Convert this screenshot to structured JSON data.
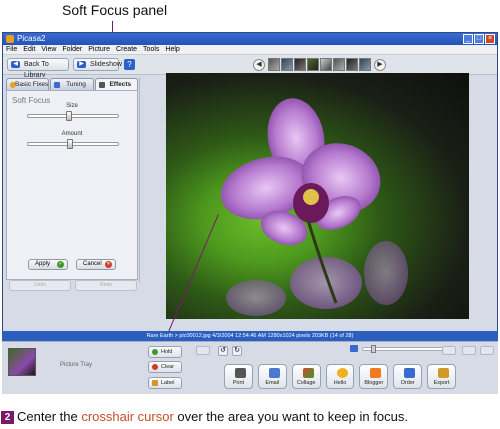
{
  "callout_top": "Soft Focus panel",
  "window": {
    "title": "Picasa2",
    "controls": [
      "_",
      "□",
      "×"
    ]
  },
  "menu": [
    "File",
    "Edit",
    "View",
    "Folder",
    "Picture",
    "Create",
    "Tools",
    "Help"
  ],
  "toolbar": {
    "back_label": "Back To Library",
    "slideshow_label": "Slideshow",
    "help_label": "?"
  },
  "tabs": [
    "Basic Fixes",
    "Tuning",
    "Effects"
  ],
  "panel": {
    "title": "Soft Focus",
    "size_label": "Size",
    "size_level": 0.45,
    "amount_label": "Amount",
    "amount_level": 0.47,
    "apply_label": "Apply",
    "cancel_label": "Cancel",
    "undo_label": "Undo",
    "redo_label": "Redo"
  },
  "status_text": "Rare Earth > pic00012.jpg    4/3/2004 12:54:46 AM    1280x1024 pixels    203KB    (14 of 28)",
  "tray": {
    "title": "Picture Tray",
    "hold_label": "Hold",
    "clear_label": "Clear",
    "label_label": "Label"
  },
  "actions": [
    "Print",
    "Email",
    "Collage",
    "Hello",
    "Blogger",
    "Order",
    "Export"
  ],
  "caption": {
    "number": "2",
    "before": "Center the ",
    "highlight": "crosshair cursor",
    "after": " over the area you want to keep in focus."
  },
  "colors": {
    "callout": "#7a1a6a",
    "highlight": "#c4502a",
    "status_bar": "#2a5fbf"
  }
}
